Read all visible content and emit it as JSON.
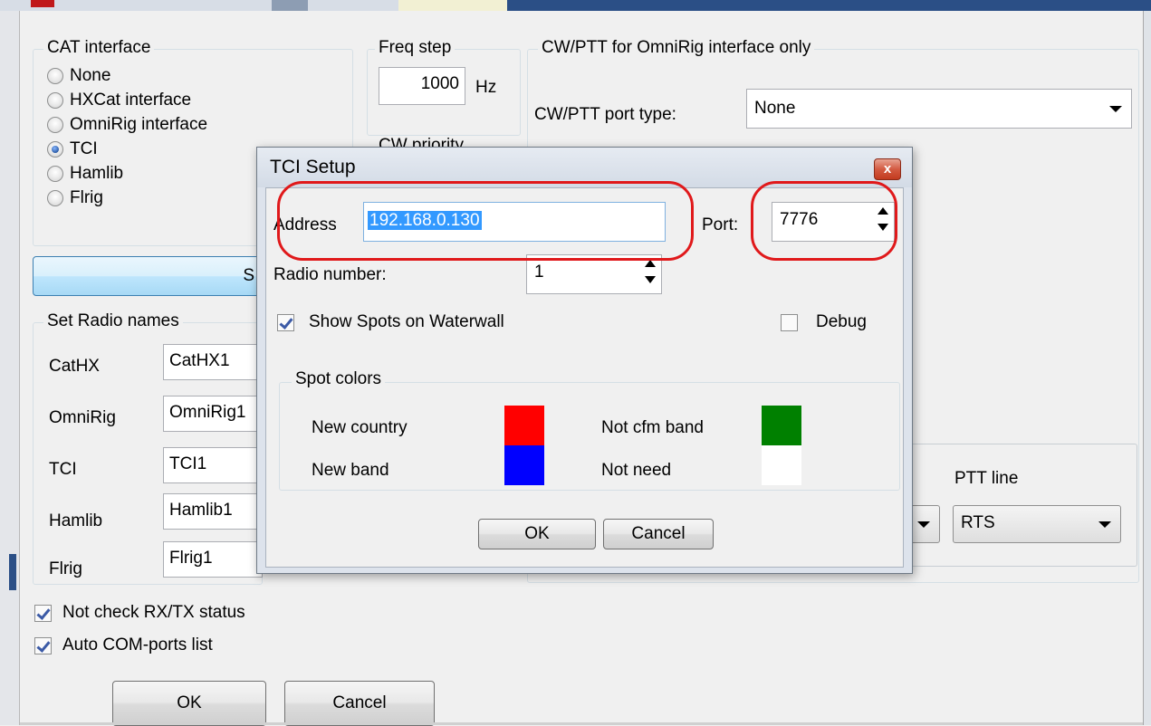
{
  "main": {
    "cat_interface": {
      "title": "CAT interface",
      "options": [
        {
          "label": "None",
          "checked": false
        },
        {
          "label": "HXCat interface",
          "checked": false
        },
        {
          "label": "OmniRig interface",
          "checked": false
        },
        {
          "label": "TCI",
          "checked": true
        },
        {
          "label": "Hamlib",
          "checked": false
        },
        {
          "label": "Flrig",
          "checked": false
        }
      ],
      "setup_button_fragment": "S"
    },
    "freq_step": {
      "title": "Freq step",
      "value": "1000",
      "unit": "Hz"
    },
    "cw_priority_fragment": "CW priority",
    "cw_ptt": {
      "title": "CW/PTT for OmniRig interface only",
      "port_type_label": "CW/PTT port type:",
      "port_type_value": "None"
    },
    "radio_names": {
      "title": "Set Radio names",
      "rows": [
        {
          "label": "CatHX",
          "value": "CatHX1"
        },
        {
          "label": "OmniRig",
          "value": "OmniRig1"
        },
        {
          "label": "TCI",
          "value": "TCI1"
        },
        {
          "label": "Hamlib",
          "value": "Hamlib1"
        },
        {
          "label": "Flrig",
          "value": "Flrig1"
        }
      ]
    },
    "ptt_line": {
      "title": "PTT line",
      "value": "RTS"
    },
    "checkboxes": [
      {
        "label": "Not check RX/TX status",
        "checked": true
      },
      {
        "label": "Auto COM-ports list",
        "checked": true
      }
    ],
    "ok_label": "OK",
    "cancel_label": "Cancel"
  },
  "dialog": {
    "title": "TCI Setup",
    "close_glyph": "x",
    "address_label": "Address",
    "address_value": "192.168.0.130",
    "port_label": "Port:",
    "port_value": "7776",
    "radio_number_label": "Radio number:",
    "radio_number_value": "1",
    "show_spots_label": "Show Spots on Waterwall",
    "show_spots_checked": true,
    "debug_label": "Debug",
    "debug_checked": false,
    "spot_colors": {
      "title": "Spot colors",
      "items": [
        {
          "label": "New country",
          "color": "#ff0000"
        },
        {
          "label": "New band",
          "color": "#0000ff"
        },
        {
          "label": "Not cfm band",
          "color": "#008000"
        },
        {
          "label": "Not need",
          "color": "#ffffff"
        }
      ]
    },
    "ok_label": "OK",
    "cancel_label": "Cancel"
  }
}
